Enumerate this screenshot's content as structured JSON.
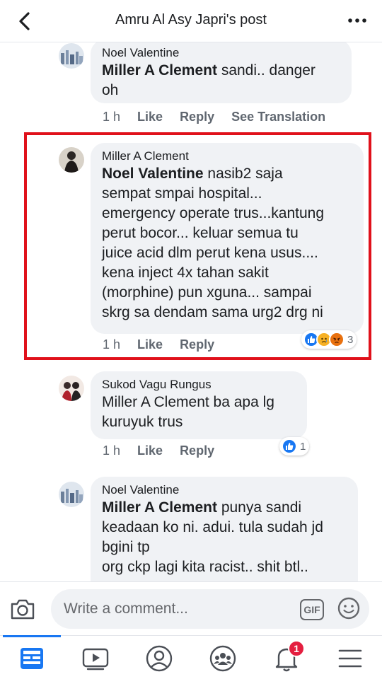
{
  "header": {
    "title": "Amru Al Asy Japri's post"
  },
  "comments": [
    {
      "author": "Noel Valentine",
      "tag": "Miller A Clement",
      "lines": [
        "sandi.. danger",
        "oh"
      ],
      "time": "1 h",
      "like": "Like",
      "reply": "Reply",
      "translate": "See Translation"
    },
    {
      "author": "Miller A Clement",
      "tag": "Noel Valentine",
      "lines": [
        "nasib2 saja",
        "sempat smpai hospital...",
        "emergency operate trus...kantung",
        "perut bocor... keluar semua tu",
        "juice acid dlm perut kena usus....",
        "kena inject 4x tahan sakit",
        "(morphine) pun xguna... sampai",
        "skrg sa dendam sama urg2 drg ni"
      ],
      "time": "1 h",
      "like": "Like",
      "reply": "Reply",
      "reaction_count": "3"
    },
    {
      "author": "Sukod Vagu Rungus",
      "lines": [
        "Miller A Clement ba apa lg",
        "kuruyuk trus"
      ],
      "time": "1 h",
      "like": "Like",
      "reply": "Reply",
      "reaction_count": "1"
    },
    {
      "author": "Noel Valentine",
      "tag": "Miller A Clement",
      "lines": [
        "punya sandi",
        "keadaan ko ni. adui. tula sudah jd",
        "bgini tp",
        "org ckp lagi kita racist.. shit btl.."
      ]
    }
  ],
  "composer": {
    "placeholder": "Write a comment...",
    "gif_label": "GIF"
  },
  "nav": {
    "notifications_badge": "1",
    "items": [
      "news-feed-icon",
      "watch-icon",
      "profile-icon",
      "groups-icon",
      "notifications-icon",
      "menu-icon"
    ]
  },
  "colors": {
    "accent": "#1877f2",
    "highlight_border": "#e0111b",
    "bubble": "#f0f2f5",
    "badge": "#e41e3f"
  }
}
